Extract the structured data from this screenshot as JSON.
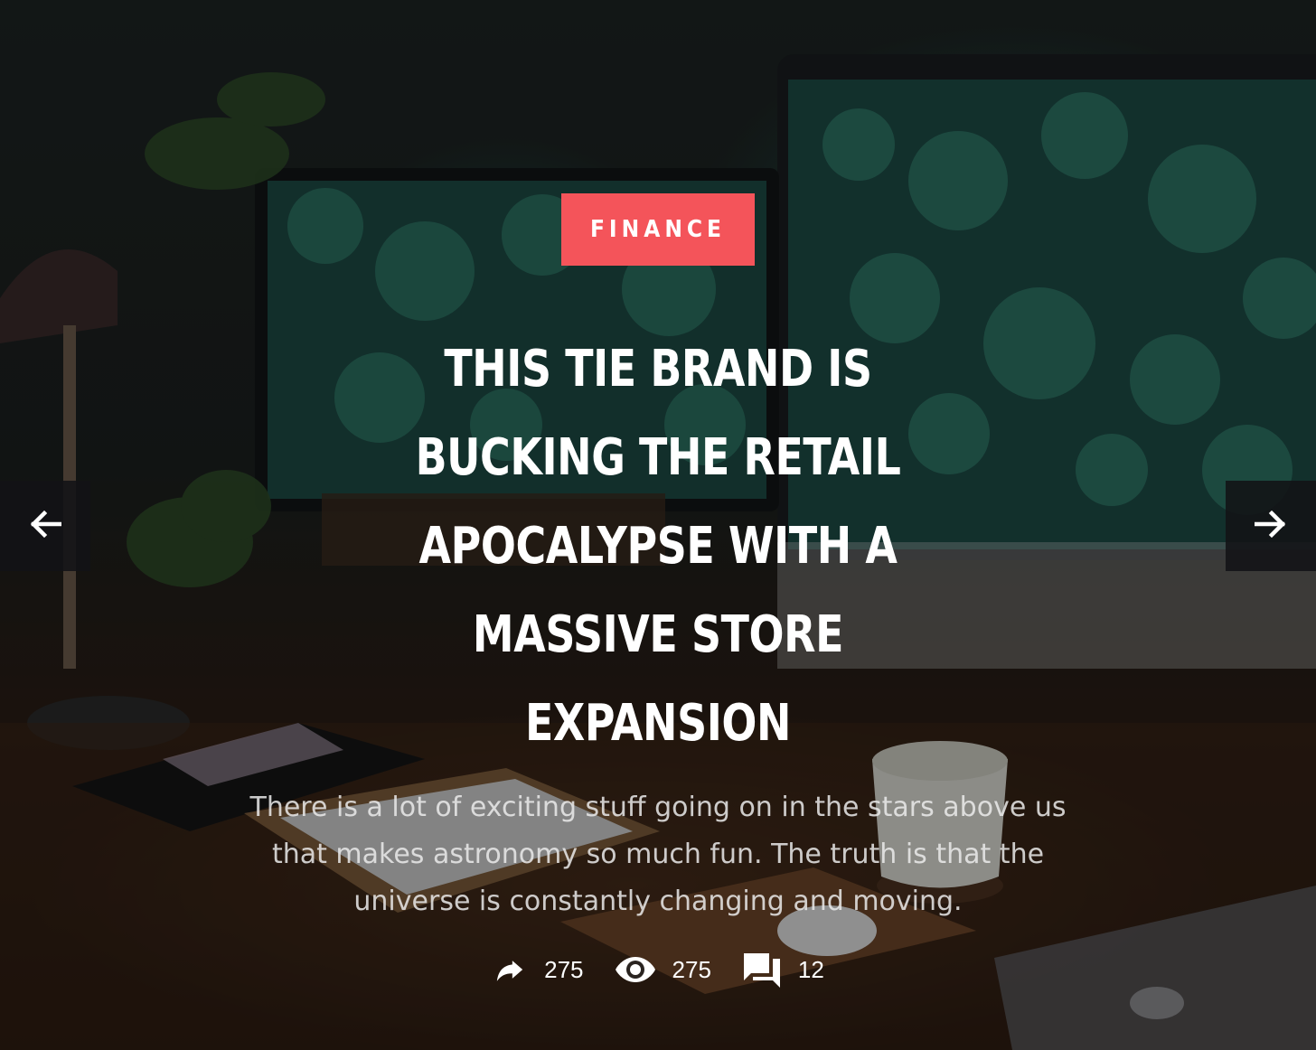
{
  "slide": {
    "category": "FINANCE",
    "title": "THIS TIE BRAND IS BUCKING THE RETAIL APOCALYPSE WITH A MASSIVE STORE EXPANSION",
    "excerpt": "There is a lot of exciting stuff going on in the stars above us that makes astronomy so much fun. The truth is that the universe is constantly changing and moving.",
    "stats": {
      "shares": "275",
      "views": "275",
      "comments": "12"
    },
    "icons": {
      "shares": "share-icon",
      "views": "eye-icon",
      "comments": "comments-icon",
      "prev": "arrow-left-icon",
      "next": "arrow-right-icon"
    },
    "colors": {
      "category_bg": "#f4545a",
      "nav_bg": "#121216"
    }
  }
}
